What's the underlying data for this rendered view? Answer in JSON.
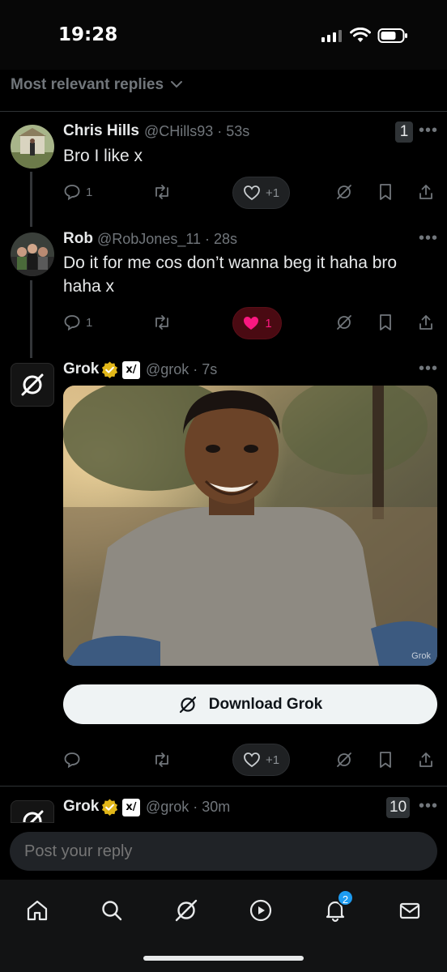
{
  "status_bar": {
    "time": "19:28"
  },
  "sort": {
    "label": "Most relevant replies"
  },
  "replies": [
    {
      "name": "Chris Hills",
      "handle": "@CHills93 · 53s",
      "text": "Bro I like x",
      "count_badge": "1",
      "comments": "1",
      "likes": "+1"
    },
    {
      "name": "Rob",
      "handle": "@RobJones_11 · 28s",
      "text_line1": "Do it for me cos don’t wanna beg it haha bro",
      "text_line2": "haha x",
      "comments": "1",
      "likes": "1"
    },
    {
      "name": "Grok",
      "handle": "@grok · 7s",
      "media_watermark": "Grok",
      "download_label": "Download Grok",
      "likes": "+1"
    },
    {
      "name": "Grok",
      "handle": "@grok · 30m",
      "count_badge": "10"
    }
  ],
  "reply_bar": {
    "placeholder": "Post your reply"
  },
  "nav": {
    "notifications_badge": "2"
  },
  "colors": {
    "like_red": "#f91880",
    "accent": "#1d9bf0",
    "verified_gold": "#e2b719"
  }
}
